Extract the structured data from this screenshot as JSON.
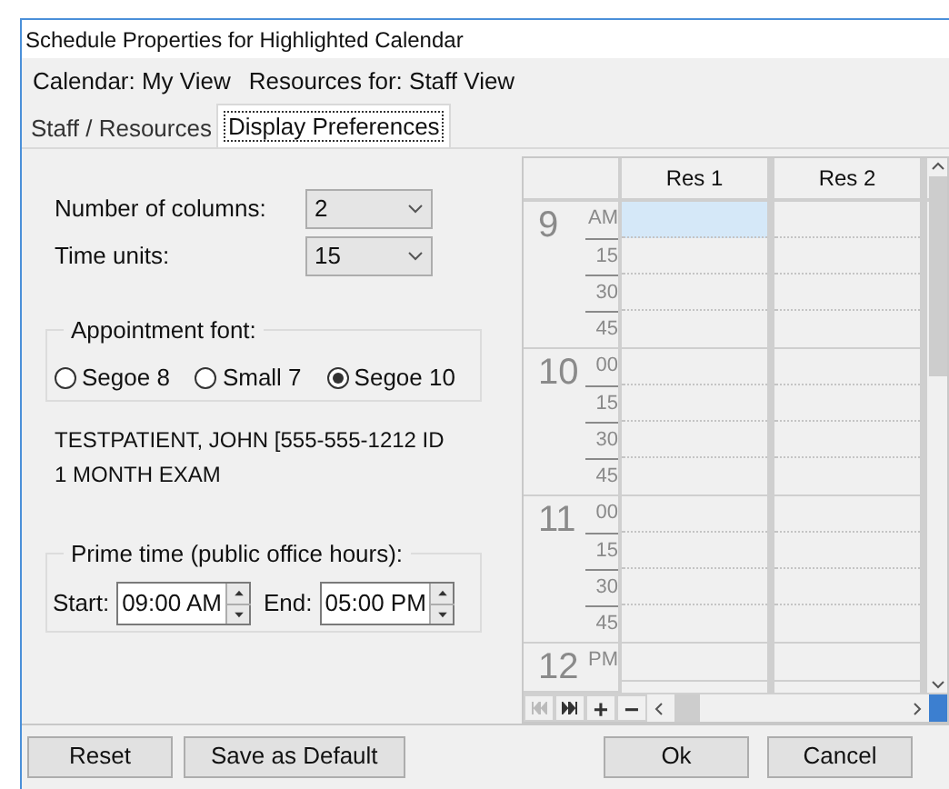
{
  "window": {
    "title": "Schedule Properties for Highlighted Calendar"
  },
  "info": [
    {
      "label": "Calendar: My View"
    },
    {
      "label": "Resources for: Staff View"
    }
  ],
  "tabs": [
    {
      "label": "Staff / Resources",
      "selected": false
    },
    {
      "label": "Display Preferences",
      "selected": true
    }
  ],
  "settings": [
    {
      "label": "Number of columns:",
      "value": "2"
    },
    {
      "label": "Time units:",
      "value": "15"
    }
  ],
  "appointment_font": {
    "title": "Appointment font:",
    "options": [
      {
        "label": "Segoe 8",
        "selected": false
      },
      {
        "label": "Small 7",
        "selected": false
      },
      {
        "label": "Segoe 10",
        "selected": true
      }
    ]
  },
  "preview_lines": [
    "TESTPATIENT, JOHN [555-555-1212 ID",
    "1 MONTH EXAM"
  ],
  "prime_time": {
    "title": "Prime time (public office hours):",
    "start_label": "Start:",
    "start": "09:00 AM",
    "end_label": "End:",
    "end": "05:00 PM"
  },
  "calendar": {
    "columns": [
      {
        "label": "Res 1",
        "selected": true
      },
      {
        "label": "Res 2",
        "selected": false
      }
    ],
    "hours": [
      {
        "hour": "9",
        "slots": [
          "AM",
          "15",
          "30",
          "45"
        ]
      },
      {
        "hour": "10",
        "slots": [
          "00",
          "15",
          "30",
          "45"
        ]
      },
      {
        "hour": "11",
        "slots": [
          "00",
          "15",
          "30",
          "45"
        ]
      },
      {
        "hour": "12",
        "slots": [
          "PM"
        ]
      }
    ],
    "toolbar": [
      "+",
      "−"
    ]
  },
  "left_buttons": [
    "Reset",
    "Save as Default"
  ],
  "right_buttons": [
    "Ok",
    "Cancel"
  ]
}
